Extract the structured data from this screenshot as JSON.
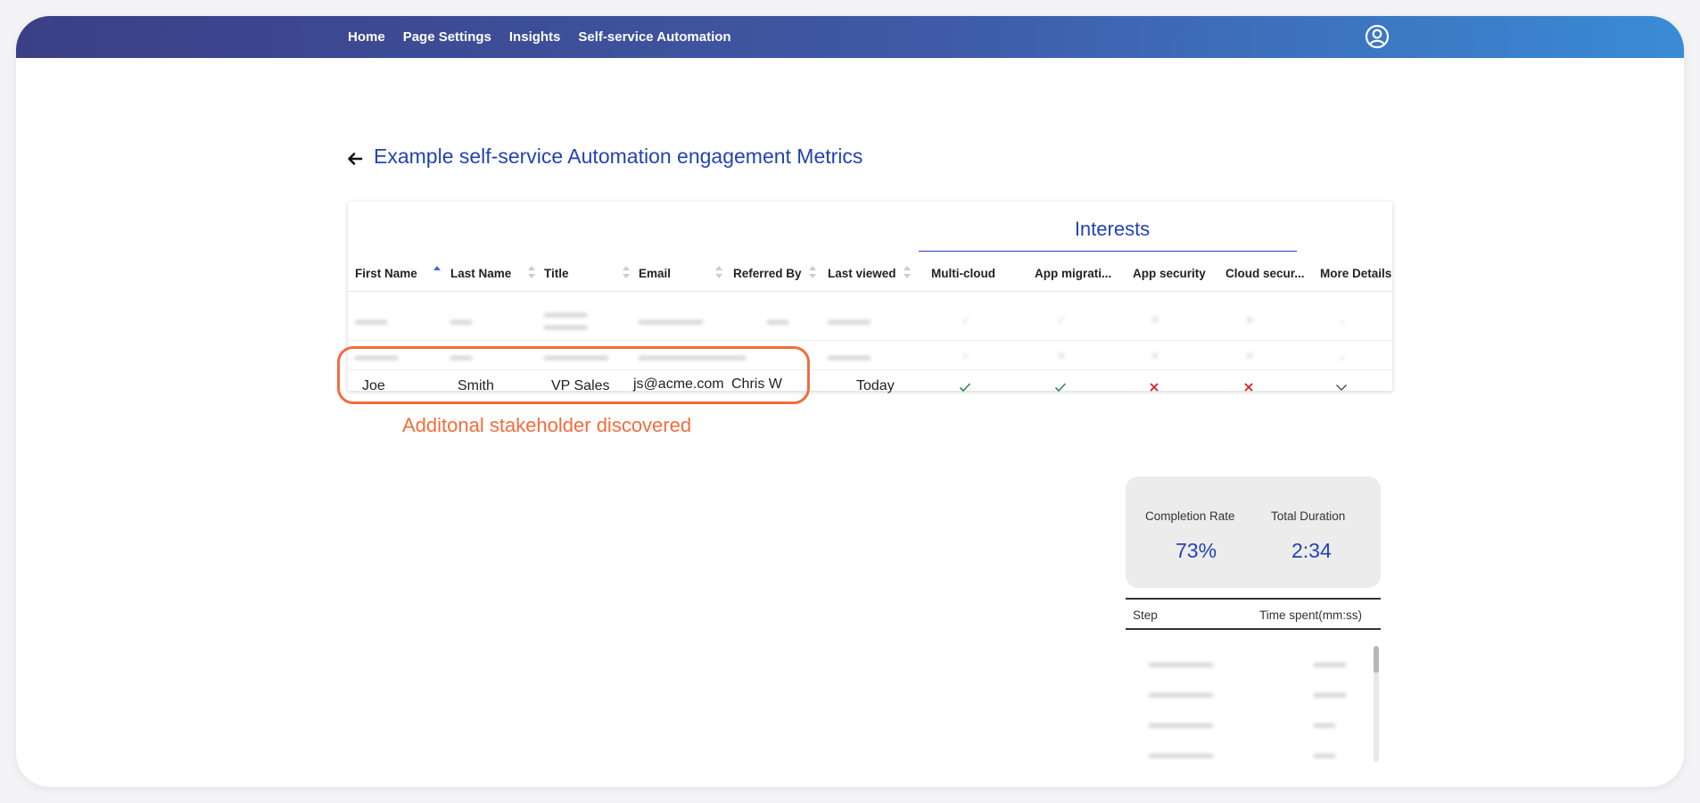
{
  "nav": {
    "items": [
      "Home",
      "Page Settings",
      "Insights",
      "Self-service Automation"
    ]
  },
  "page": {
    "title": "Example self-service Automation engagement Metrics"
  },
  "table": {
    "interests_title": "Interests",
    "columns": [
      "First Name",
      "Last Name",
      "Title",
      "Email",
      "Referred By",
      "Last viewed",
      "Multi-cloud",
      "App migrati...",
      "App security",
      "Cloud secur...",
      "More Details"
    ],
    "sorted_column": "First Name",
    "highlighted_row": {
      "first_name": "Joe",
      "last_name": "Smith",
      "title": "VP Sales",
      "email": "js@acme.com",
      "referred_by": "Chris W",
      "last_viewed": "Today",
      "interests": [
        true,
        true,
        false,
        false
      ]
    }
  },
  "annotation": "Additonal stakeholder discovered",
  "stats": {
    "completion_rate_label": "Completion Rate",
    "completion_rate_value": "73%",
    "total_duration_label": "Total Duration",
    "total_duration_value": "2:34"
  },
  "steps_table": {
    "columns": [
      "Step",
      "Time spent(mm:ss)"
    ]
  },
  "colors": {
    "accent": "#2343b0",
    "highlight": "#f26d3d",
    "check": "#2a8a4a",
    "cross": "#d62020"
  }
}
